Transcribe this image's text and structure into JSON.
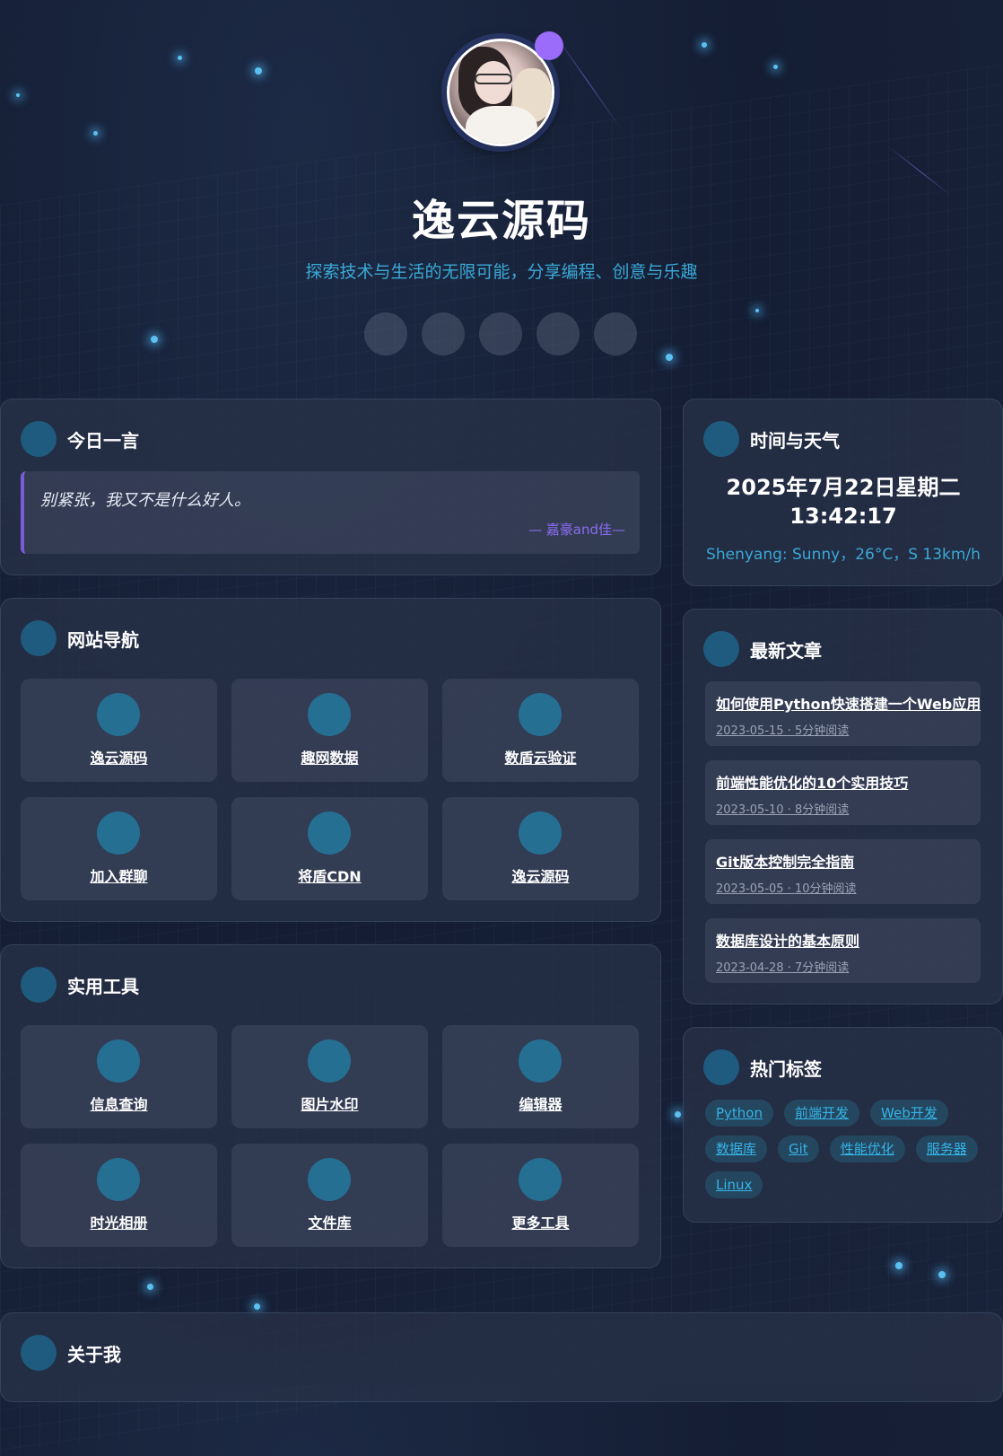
{
  "header": {
    "title": "逸云源码",
    "subtitle": "探索技术与生活的无限可能，分享编程、创意与乐趣",
    "socials": [
      "social-icon-1",
      "social-icon-2",
      "social-icon-3",
      "social-icon-4",
      "social-icon-5"
    ]
  },
  "quote_card": {
    "title": "今日一言",
    "text": "别紧张，我又不是什么好人。",
    "author": "— 嘉豪and佳—"
  },
  "nav_card": {
    "title": "网站导航",
    "items": [
      "逸云源码",
      "趣网数据",
      "数盾云验证",
      "加入群聊",
      "将盾CDN",
      "逸云源码"
    ]
  },
  "tools_card": {
    "title": "实用工具",
    "items": [
      "信息查询",
      "图片水印",
      "编辑器",
      "时光相册",
      "文件库",
      "更多工具"
    ]
  },
  "weather_card": {
    "title": "时间与天气",
    "date": "2025年7月22日星期二",
    "time": "13:42:17",
    "weather": "Shenyang: Sunny，26°C，S 13km/h"
  },
  "articles_card": {
    "title": "最新文章",
    "items": [
      {
        "title": "如何使用Python快速搭建一个Web应用",
        "meta": "2023-05-15 · 5分钟阅读"
      },
      {
        "title": "前端性能优化的10个实用技巧",
        "meta": "2023-05-10 · 8分钟阅读"
      },
      {
        "title": "Git版本控制完全指南",
        "meta": "2023-05-05 · 10分钟阅读"
      },
      {
        "title": "数据库设计的基本原则",
        "meta": "2023-04-28 · 7分钟阅读"
      }
    ]
  },
  "tags_card": {
    "title": "热门标签",
    "tags": [
      "Python",
      "前端开发",
      "Web开发",
      "数据库",
      "Git",
      "性能优化",
      "服务器",
      "Linux"
    ]
  },
  "about_card": {
    "title": "关于我"
  },
  "colors": {
    "accent_blue": "#3aa9d6",
    "accent_purple": "#9b6bfa",
    "icon_teal": "#256f93"
  }
}
